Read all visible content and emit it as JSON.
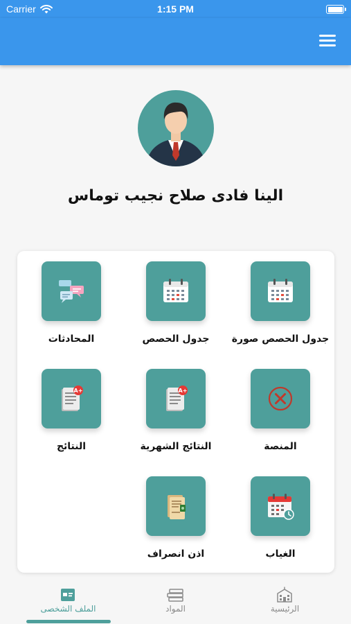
{
  "status_bar": {
    "carrier": "Carrier",
    "time": "1:15 PM"
  },
  "app_bar": {
    "menu_icon": "hamburger-menu-icon"
  },
  "profile": {
    "name": "الينا فادى صلاح نجيب توماس",
    "avatar_icon": "businessman-avatar"
  },
  "tiles": [
    {
      "label": "جدول الحصص صورة",
      "icon": "calendar-icon"
    },
    {
      "label": "جدول الحصص",
      "icon": "calendar-icon"
    },
    {
      "label": "المحادثات",
      "icon": "chat-bubbles-icon"
    },
    {
      "label": "المنصة",
      "icon": "close-circle-icon"
    },
    {
      "label": "النتائج الشهرية",
      "icon": "report-grade-icon"
    },
    {
      "label": "النتائج",
      "icon": "report-grade-icon"
    },
    {
      "label": "الغياب",
      "icon": "attendance-calendar-icon"
    },
    {
      "label": "اذن انصراف",
      "icon": "permission-document-icon"
    }
  ],
  "bottom_nav": [
    {
      "label": "الرئيسية",
      "icon": "school-building-icon",
      "active": false
    },
    {
      "label": "المواد",
      "icon": "books-stack-icon",
      "active": false
    },
    {
      "label": "الملف الشخصى",
      "icon": "profile-card-icon",
      "active": true
    }
  ],
  "colors": {
    "primary": "#3a96ec",
    "accent": "#4e9f9b"
  }
}
